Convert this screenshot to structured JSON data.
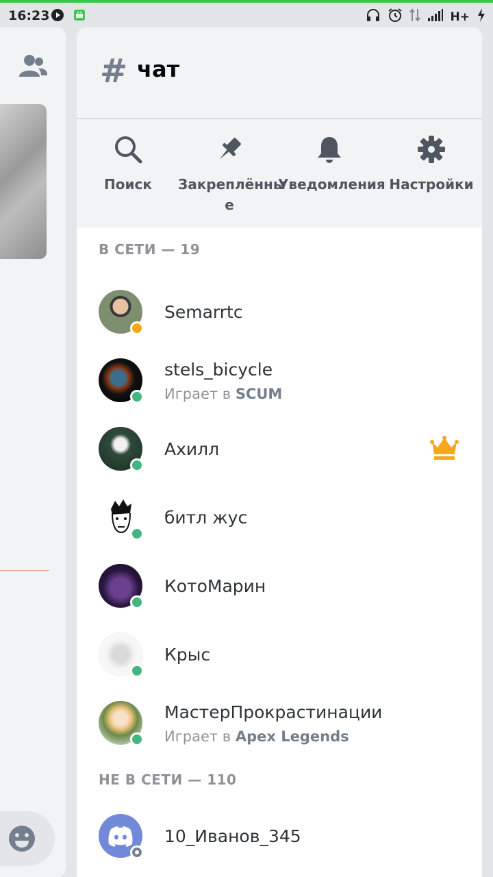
{
  "status_bar": {
    "time": "16:23",
    "network": "H+"
  },
  "channel": {
    "hash_symbol": "#",
    "name": "чат"
  },
  "toolbar": {
    "search_label": "Поиск",
    "pinned_label": "Закреплённы",
    "pinned_label_wrap": "е",
    "notifications_label": "Уведомления",
    "settings_label": "Настройки"
  },
  "online_header": "В СЕТИ — 19",
  "offline_header": "НЕ В СЕТИ — 110",
  "members_online": [
    {
      "name": "Semarrtc",
      "status": "idle",
      "activity_prefix": "",
      "activity_game": ""
    },
    {
      "name": "stels_bicycle",
      "status": "online",
      "activity_prefix": "Играет в",
      "activity_game": "SCUM"
    },
    {
      "name": "Ахилл",
      "status": "online",
      "activity_prefix": "",
      "activity_game": "",
      "owner": true
    },
    {
      "name": "битл жус",
      "status": "online",
      "activity_prefix": "",
      "activity_game": ""
    },
    {
      "name": "КотоМарин",
      "status": "online",
      "activity_prefix": "",
      "activity_game": ""
    },
    {
      "name": "Крыс",
      "status": "online",
      "activity_prefix": "",
      "activity_game": ""
    },
    {
      "name": "МастерПрокрастинации",
      "status": "online",
      "activity_prefix": "Играет в",
      "activity_game": "Apex Legends"
    }
  ],
  "members_offline": [
    {
      "name": "10_Иванов_345",
      "status": "offline"
    }
  ],
  "colors": {
    "online": "#43b581",
    "idle": "#faa61a",
    "crown": "#faa61a",
    "discord_blurple": "#7289da"
  }
}
